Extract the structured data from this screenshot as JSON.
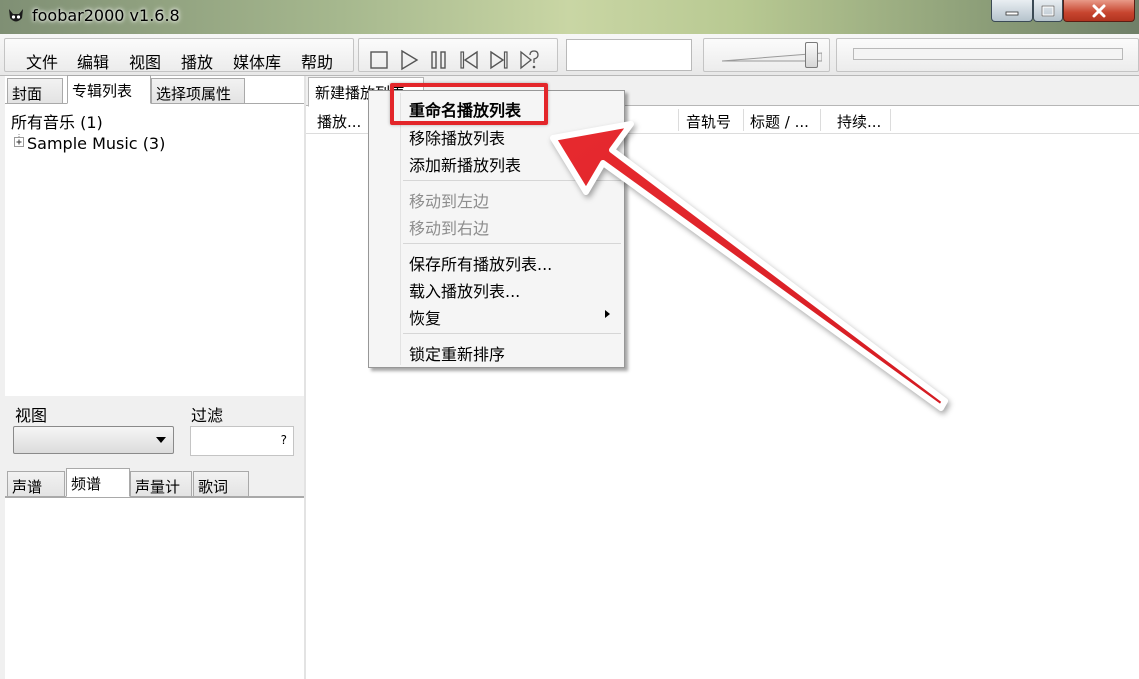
{
  "window": {
    "title": "foobar2000 v1.6.8",
    "accent_color": "#e3262a"
  },
  "menubar": {
    "items": [
      "文件",
      "编辑",
      "视图",
      "播放",
      "媒体库",
      "帮助"
    ],
    "toolbar_icons": [
      "stop-icon",
      "play-icon",
      "pause-icon",
      "previous-icon",
      "next-icon",
      "random-icon"
    ]
  },
  "left_panel": {
    "top_tabs": [
      "封面",
      "专辑列表",
      "选择项属性"
    ],
    "active_top_tab": "专辑列表",
    "tree": {
      "root": "所有音乐 (1)",
      "child": "Sample Music (3)"
    },
    "view_label": "视图",
    "filter_label": "过滤",
    "filter_help": "?",
    "bottom_tabs": [
      "声谱",
      "频谱",
      "声量计",
      "歌词"
    ],
    "active_bottom_tab": "频谱"
  },
  "playlist": {
    "tab_label": "新建播放列表",
    "columns": [
      "播放...",
      "音轨号",
      "标题 / ...",
      "持续..."
    ]
  },
  "context_menu": {
    "items": [
      {
        "label": "重命名播放列表",
        "enabled": true,
        "bold": true
      },
      {
        "label": "移除播放列表",
        "enabled": true
      },
      {
        "label": "添加新播放列表",
        "enabled": true
      },
      {
        "label": "移动到左边",
        "enabled": false
      },
      {
        "label": "移动到右边",
        "enabled": false
      },
      {
        "label": "保存所有播放列表...",
        "enabled": true
      },
      {
        "label": "载入播放列表...",
        "enabled": true
      },
      {
        "label": "恢复",
        "enabled": true,
        "submenu": true
      },
      {
        "label": "锁定重新排序",
        "enabled": true
      }
    ]
  }
}
